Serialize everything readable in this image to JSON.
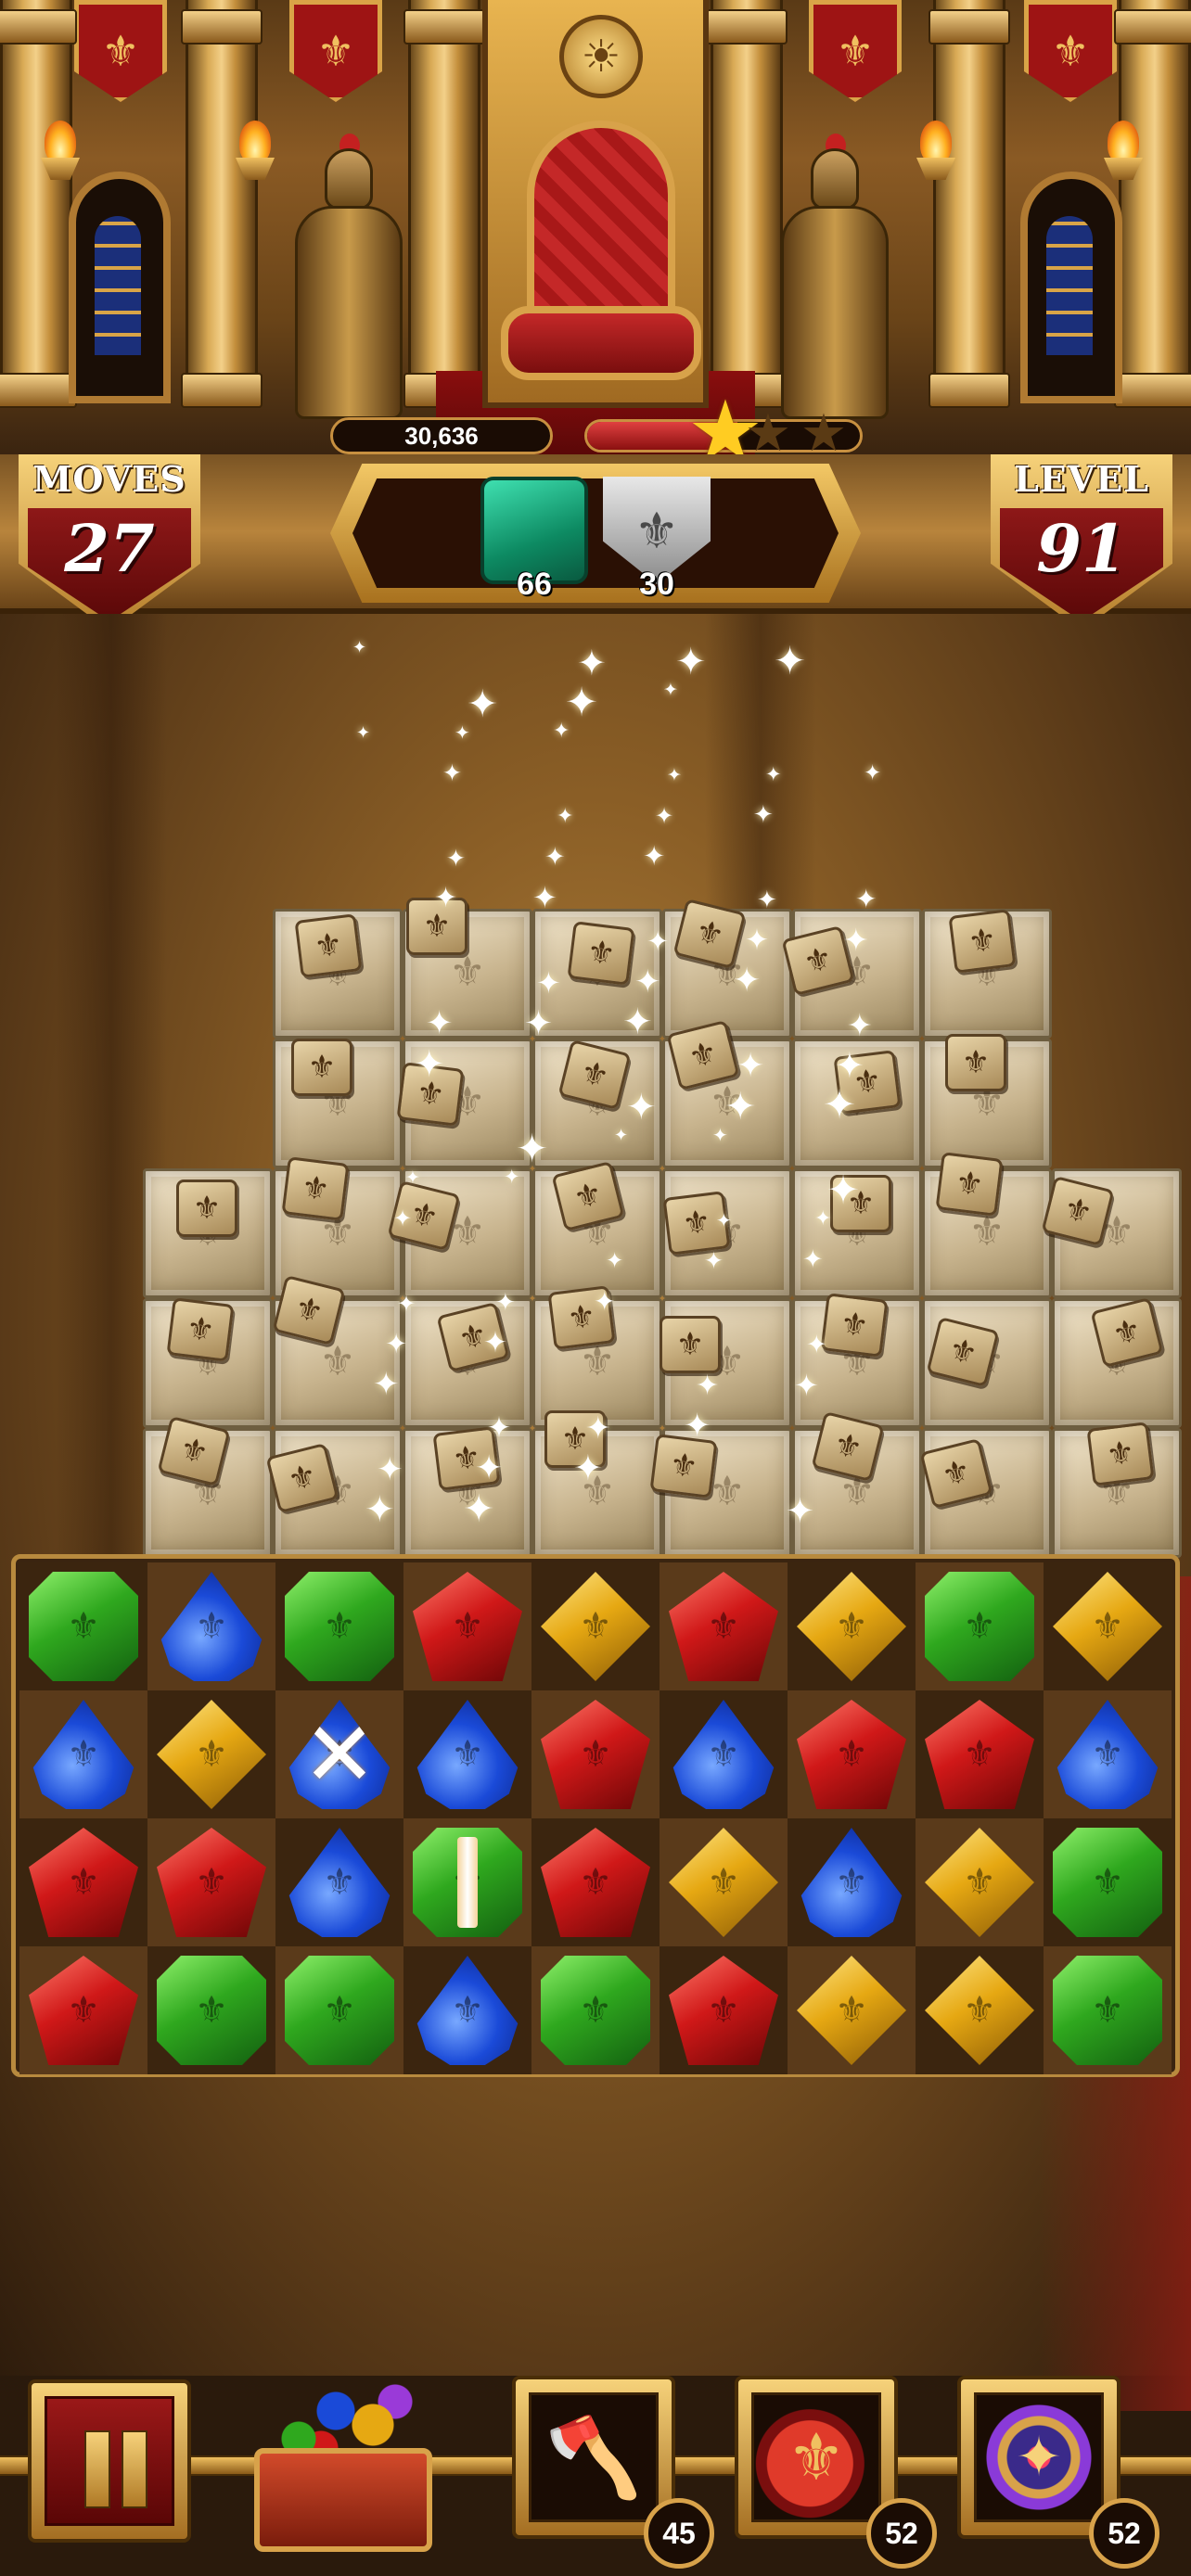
{
  "hud": {
    "score": "30,636",
    "score_progress_percent": 55,
    "stars_earned": 1,
    "stars_total": 3,
    "moves_label": "MOVES",
    "moves_value": "27",
    "level_label": "LEVEL",
    "level_value": "91"
  },
  "goals": [
    {
      "icon": "emerald-block-icon",
      "count": "66"
    },
    {
      "icon": "silver-shield-icon",
      "count": "30"
    }
  ],
  "board": {
    "rows": 4,
    "cols": 9,
    "gems": [
      [
        "green",
        "blue",
        "green",
        "red",
        "yellow",
        "red",
        "yellow",
        "green",
        "yellow"
      ],
      [
        "blue",
        "yellow",
        "blue-cross",
        "blue",
        "red",
        "blue",
        "red",
        "red",
        "blue"
      ],
      [
        "red",
        "red",
        "blue",
        "green-vertical",
        "red",
        "yellow",
        "blue",
        "yellow",
        "green"
      ],
      [
        "red",
        "green",
        "green",
        "blue",
        "green",
        "red",
        "yellow",
        "yellow",
        "green"
      ]
    ]
  },
  "boosters": [
    {
      "name": "axe",
      "icon": "axe-icon",
      "count": "45"
    },
    {
      "name": "bomb",
      "icon": "bomb-icon",
      "count": "52"
    },
    {
      "name": "compass",
      "icon": "compass-icon",
      "count": "52"
    }
  ],
  "colors": {
    "gold": "#d8a24a",
    "crimson": "#9a1818",
    "emerald": "#0d8a62"
  }
}
